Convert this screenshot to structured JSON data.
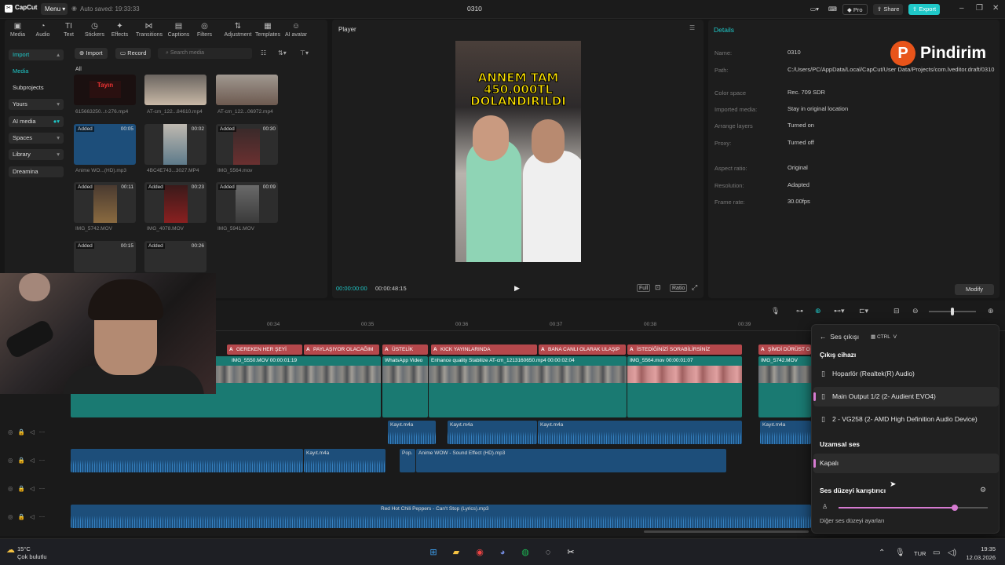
{
  "app": {
    "name": "CapCut",
    "menu_label": "Menu",
    "autosave": "Auto saved: 19:33:33",
    "project_title": "0310",
    "pro_label": "Pro",
    "share_label": "Share",
    "export_label": "Export",
    "accent": "#1fc8c8"
  },
  "tools": [
    {
      "label": "Media",
      "icon": "media-icon"
    },
    {
      "label": "Audio",
      "icon": "audio-icon"
    },
    {
      "label": "Text",
      "icon": "text-icon"
    },
    {
      "label": "Stickers",
      "icon": "stickers-icon"
    },
    {
      "label": "Effects",
      "icon": "effects-icon"
    },
    {
      "label": "Transitions",
      "icon": "transitions-icon"
    },
    {
      "label": "Captions",
      "icon": "captions-icon"
    },
    {
      "label": "Filters",
      "icon": "filters-icon"
    },
    {
      "label": "Adjustment",
      "icon": "adjustment-icon"
    },
    {
      "label": "Templates",
      "icon": "templates-icon"
    },
    {
      "label": "AI avatar",
      "icon": "ai-avatar-icon"
    }
  ],
  "sidebar": {
    "items": [
      {
        "label": "Import"
      },
      {
        "label": "Media"
      },
      {
        "label": "Subprojects"
      },
      {
        "label": "Yours"
      },
      {
        "label": "AI media"
      },
      {
        "label": "Spaces"
      },
      {
        "label": "Library"
      },
      {
        "label": "Dreamina"
      }
    ]
  },
  "media": {
    "import_label": "Import",
    "record_label": "Record",
    "search_placeholder": "Search media",
    "filter_all": "All",
    "items": [
      {
        "name": "615663250...t-276.mp4",
        "added": "",
        "duration": ""
      },
      {
        "name": "AT-cm_122...84610.mp4",
        "added": "",
        "duration": ""
      },
      {
        "name": "AT-cm_122...06972.mp4",
        "added": "",
        "duration": ""
      },
      {
        "name": "Anime WO...(HD).mp3",
        "added": "Added",
        "duration": "00:05"
      },
      {
        "name": "4BC4E743...3027.MP4",
        "added": "",
        "duration": "00:02"
      },
      {
        "name": "IMG_5564.mov",
        "added": "Added",
        "duration": "00:30"
      },
      {
        "name": "IMG_5742.MOV",
        "added": "Added",
        "duration": "00:11"
      },
      {
        "name": "IMG_4078.MOV",
        "added": "Added",
        "duration": "00:23"
      },
      {
        "name": "IMG_5941.MOV",
        "added": "Added",
        "duration": "00:09"
      },
      {
        "name": "",
        "added": "Added",
        "duration": "00:15"
      },
      {
        "name": "",
        "added": "Added",
        "duration": "00:26"
      }
    ]
  },
  "player": {
    "title": "Player",
    "caption": "ANNEM TAM 450.000TL DOLANDIRILDI",
    "time_current": "00:00:00:00",
    "time_total": "00:00:48:15",
    "full_label": "Full",
    "ratio_label": "Ratio"
  },
  "details": {
    "title": "Details",
    "modify_label": "Modify",
    "rows": [
      {
        "key": "Name:",
        "value": "0310"
      },
      {
        "key": "Path:",
        "value": "C:/Users/PC/AppData/Local/CapCut/User Data/Projects/com.lveditor.draft/0310"
      },
      {
        "key": "Color space",
        "value": "Rec. 709 SDR"
      },
      {
        "key": "Imported media:",
        "value": "Stay in original location"
      },
      {
        "key": "Arrange layers",
        "value": "Turned on"
      },
      {
        "key": "Proxy:",
        "value": "Turned off"
      },
      {
        "key": "Aspect ratio:",
        "value": "Original"
      },
      {
        "key": "Resolution:",
        "value": "Adapted"
      },
      {
        "key": "Frame rate:",
        "value": "30.00fps"
      }
    ]
  },
  "watermark": "Pindirim",
  "timeline": {
    "ticks": [
      "00:34",
      "00:35",
      "00:36",
      "00:37",
      "00:38",
      "00:39"
    ],
    "titles": [
      "GEREKEN HER ŞEYİ",
      "PAYLAŞIYOR OLACAĞIM",
      "ÜSTELİK",
      "KICK YAYINLARINDA",
      "BANA CANLI OLARAK ULAŞIP",
      "İSTEDİĞİNİZİ SORABİLİRSİNİZ",
      "ŞİMDİ DÜRÜST O"
    ],
    "video_clips": [
      "IMG_5550.MOV  00:00:01:19",
      "WhatsApp Video",
      "Enhance quality  Stabilize  AT-cm_1213160650.mp4  00:00:02:04",
      "IMG_5564.mov  00:00:01:07",
      "IMG_5742.MOV"
    ],
    "audio_a": [
      "Kayıt.m4a",
      "Kayıt.m4a",
      "Kayıt.m4a",
      "Kayıt.m4a"
    ],
    "audio_b": [
      "Kayıt.m4a",
      "Pop.",
      "Anime WOW - Sound Effect (HD).mp3"
    ],
    "music": "Red Hot Chili Peppers - Can't Stop (Lyrics).mp3"
  },
  "sound_flyout": {
    "header": "Ses çıkışı",
    "shortcut_ctrl": "CTRL",
    "shortcut_v": "V",
    "output_section": "Çıkış cihazı",
    "devices": [
      "Hoparlör (Realtek(R) Audio)",
      "Main Output 1/2 (2- Audient EVO4)",
      "2 - VG258 (2- AMD High Definition Audio Device)"
    ],
    "spatial_section": "Uzamsal ses",
    "spatial_value": "Kapalı",
    "mixer_section": "Ses düzeyi karıştırıcı",
    "volume_level": 0.78,
    "other_label": "Diğer ses düzeyi ayarları"
  },
  "taskbar": {
    "temp": "15°C",
    "weather": "Çok bulutlu",
    "lang": "TUR",
    "time": "19:35",
    "date": "12.03.2026"
  }
}
